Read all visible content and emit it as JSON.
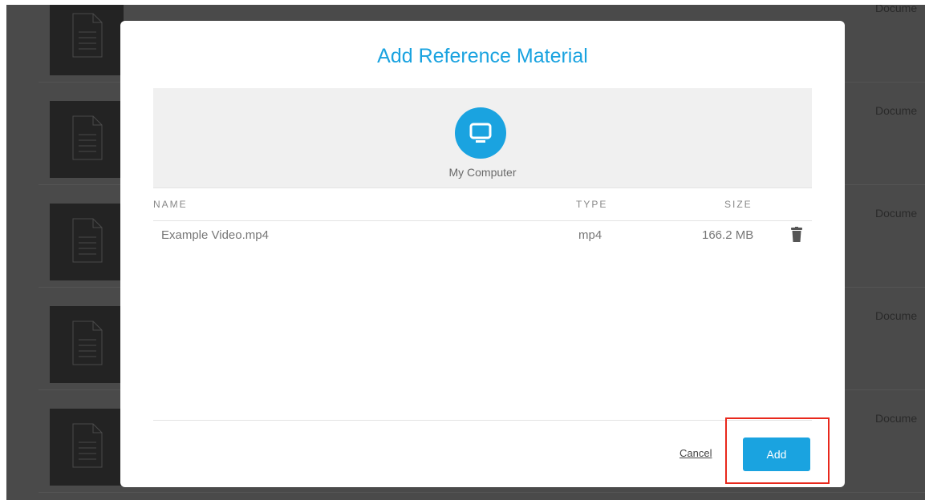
{
  "background": {
    "rows": [
      {
        "type": "Docume"
      },
      {
        "type": "Docume"
      },
      {
        "type": "Docume"
      },
      {
        "type": "Docume"
      },
      {
        "type": "Docume"
      }
    ]
  },
  "modal": {
    "title": "Add Reference Material",
    "source": {
      "label": "My Computer",
      "icon": "monitor-icon"
    },
    "table": {
      "headers": {
        "name": "NAME",
        "type": "TYPE",
        "size": "SIZE"
      },
      "rows": [
        {
          "name": "Example Video.mp4",
          "type": "mp4",
          "size": "166.2 MB",
          "action_icon": "trash-icon"
        }
      ]
    },
    "footer": {
      "cancel_label": "Cancel",
      "add_label": "Add"
    }
  },
  "colors": {
    "accent": "#1aa3e0",
    "highlight": "#e8281c",
    "overlay": "#4a4a4a"
  }
}
